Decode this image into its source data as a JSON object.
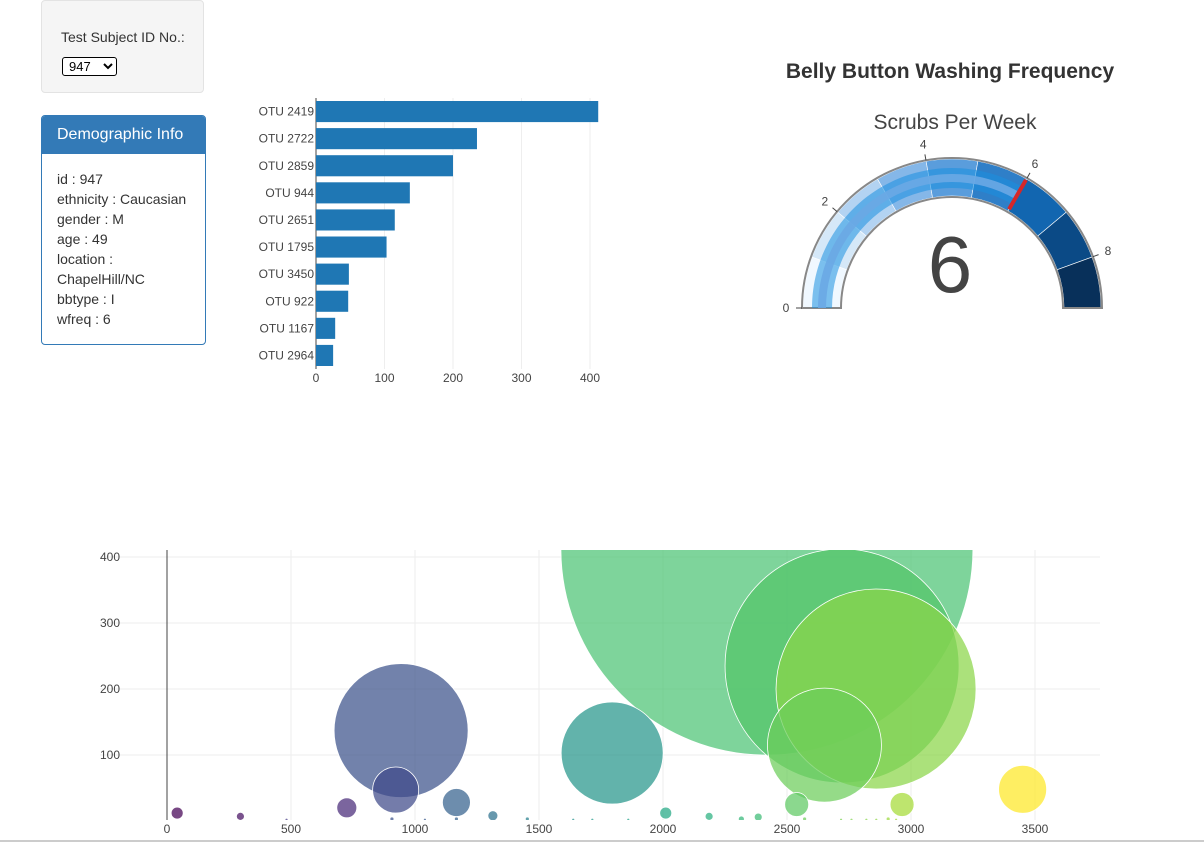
{
  "selector": {
    "label": "Test Subject ID No.:",
    "selected": "947",
    "options": [
      "947"
    ]
  },
  "demographics": {
    "heading": "Demographic Info",
    "lines": [
      "id : 947",
      "ethnicity : Caucasian",
      "gender : M",
      "age : 49",
      "location :",
      "ChapelHill/NC",
      "bbtype : I",
      "wfreq : 6"
    ]
  },
  "gauge": {
    "title": "Belly Button Washing Frequency",
    "subtitle": "Scrubs Per Week",
    "value_label": "6",
    "value": 6,
    "range": [
      0,
      9
    ],
    "tick_labels": [
      "0",
      "2",
      "4",
      "6",
      "8"
    ],
    "band_colors": [
      "#f0f8ff",
      "#d5e8f8",
      "#b3d3f2",
      "#85b7e8",
      "#5a9ddc",
      "#2f7fc8",
      "#1266b0",
      "#0b4a86",
      "#08305a"
    ],
    "needle_color": "#d62728"
  },
  "chart_data": [
    {
      "type": "bar",
      "orientation": "horizontal",
      "categories": [
        "OTU 2419",
        "OTU 2722",
        "OTU 2859",
        "OTU 944",
        "OTU 2651",
        "OTU 1795",
        "OTU 3450",
        "OTU 922",
        "OTU 1167",
        "OTU 2964"
      ],
      "values": [
        412,
        235,
        200,
        137,
        115,
        103,
        48,
        47,
        28,
        25
      ],
      "xlim": [
        0,
        420
      ],
      "xticks": [
        "0",
        "100",
        "200",
        "300",
        "400"
      ],
      "color": "#1f77b4"
    },
    {
      "type": "scatter",
      "variant": "bubble",
      "xlim": [
        -60,
        3760
      ],
      "ylim": [
        0,
        410
      ],
      "xticks": [
        "0",
        "500",
        "1000",
        "1500",
        "2000",
        "2500",
        "3000",
        "3500"
      ],
      "yticks": [
        "100",
        "200",
        "300",
        "400"
      ],
      "points": [
        {
          "x": 2419,
          "y": 412,
          "r": 206,
          "color": "#4cc375"
        },
        {
          "x": 2722,
          "y": 235,
          "r": 117,
          "color": "#53c568"
        },
        {
          "x": 2859,
          "y": 200,
          "r": 100,
          "color": "#8ad548"
        },
        {
          "x": 2651,
          "y": 115,
          "r": 57,
          "color": "#6ccd5a"
        },
        {
          "x": 944,
          "y": 137,
          "r": 67,
          "color": "#3b528b"
        },
        {
          "x": 1795,
          "y": 103,
          "r": 51,
          "color": "#26968a"
        },
        {
          "x": 3450,
          "y": 48,
          "r": 24,
          "color": "#fde725"
        },
        {
          "x": 922,
          "y": 47,
          "r": 23,
          "color": "#3e4a89"
        },
        {
          "x": 1167,
          "y": 28,
          "r": 14,
          "color": "#34618d"
        },
        {
          "x": 2964,
          "y": 25,
          "r": 12,
          "color": "#a5db36"
        },
        {
          "x": 2539,
          "y": 25,
          "r": 12,
          "color": "#5ec962"
        },
        {
          "x": 725,
          "y": 20,
          "r": 10,
          "color": "#482979"
        },
        {
          "x": 41,
          "y": 12,
          "r": 6,
          "color": "#440154"
        },
        {
          "x": 2011,
          "y": 12,
          "r": 6,
          "color": "#22a884"
        },
        {
          "x": 1314,
          "y": 8,
          "r": 5,
          "color": "#2d708e"
        },
        {
          "x": 296,
          "y": 7,
          "r": 4,
          "color": "#471063"
        },
        {
          "x": 2186,
          "y": 7,
          "r": 4,
          "color": "#2ab07f"
        },
        {
          "x": 2384,
          "y": 6,
          "r": 4,
          "color": "#3bbb75"
        },
        {
          "x": 2316,
          "y": 3,
          "r": 3,
          "color": "#35b779"
        },
        {
          "x": 1453,
          "y": 3,
          "r": 2,
          "color": "#277f8e"
        },
        {
          "x": 1167,
          "y": 3,
          "r": 2,
          "color": "#34618d"
        },
        {
          "x": 907,
          "y": 3,
          "r": 2,
          "color": "#3b528b"
        },
        {
          "x": 2571,
          "y": 3,
          "r": 2,
          "color": "#6ccd5a"
        },
        {
          "x": 2908,
          "y": 3,
          "r": 2,
          "color": "#9bd93c"
        },
        {
          "x": 482,
          "y": 2,
          "r": 1.5,
          "color": "#443983"
        },
        {
          "x": 1638,
          "y": 2,
          "r": 1.5,
          "color": "#21918c"
        },
        {
          "x": 1715,
          "y": 2,
          "r": 1.5,
          "color": "#1f9a8a"
        },
        {
          "x": 2718,
          "y": 2,
          "r": 1.5,
          "color": "#7ad151"
        },
        {
          "x": 2760,
          "y": 2,
          "r": 1.5,
          "color": "#80d34e"
        },
        {
          "x": 2820,
          "y": 2,
          "r": 1.5,
          "color": "#86d549"
        },
        {
          "x": 2860,
          "y": 2,
          "r": 1.5,
          "color": "#8ed645"
        },
        {
          "x": 2940,
          "y": 2,
          "r": 1.5,
          "color": "#a0da39"
        },
        {
          "x": 1860,
          "y": 2,
          "r": 1.5,
          "color": "#1fa188"
        },
        {
          "x": 1040,
          "y": 2,
          "r": 1.5,
          "color": "#38588c"
        }
      ]
    }
  ]
}
